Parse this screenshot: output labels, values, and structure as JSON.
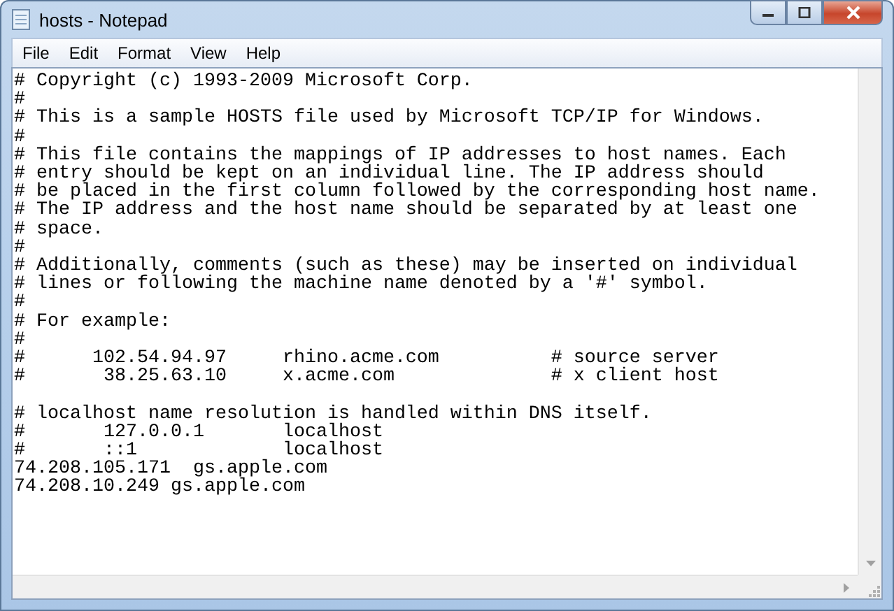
{
  "window": {
    "title": "hosts - Notepad"
  },
  "menu": [
    "File",
    "Edit",
    "Format",
    "View",
    "Help"
  ],
  "editor": {
    "blocks": [
      [
        "# Copyright (c) 1993-2009 Microsoft Corp.",
        "#",
        "# This is a sample HOSTS file used by Microsoft TCP/IP for Windows.",
        "#",
        "# This file contains the mappings of IP addresses to host names. Each",
        "# entry should be kept on an individual line. The IP address should",
        "# be placed in the first column followed by the corresponding host name.",
        "# The IP address and the host name should be separated by at least one",
        "# space.",
        "#",
        "# Additionally, comments (such as these) may be inserted on individual",
        "# lines or following the machine name denoted by a '#' symbol.",
        "#",
        "# For example:",
        "#",
        "#      102.54.94.97     rhino.acme.com          # source server",
        "#       38.25.63.10     x.acme.com              # x client host"
      ],
      [
        "# localhost name resolution is handled within DNS itself.",
        "#       127.0.0.1       localhost",
        "#       ::1             localhost",
        "74.208.105.171  gs.apple.com",
        "74.208.10.249 gs.apple.com"
      ]
    ]
  }
}
